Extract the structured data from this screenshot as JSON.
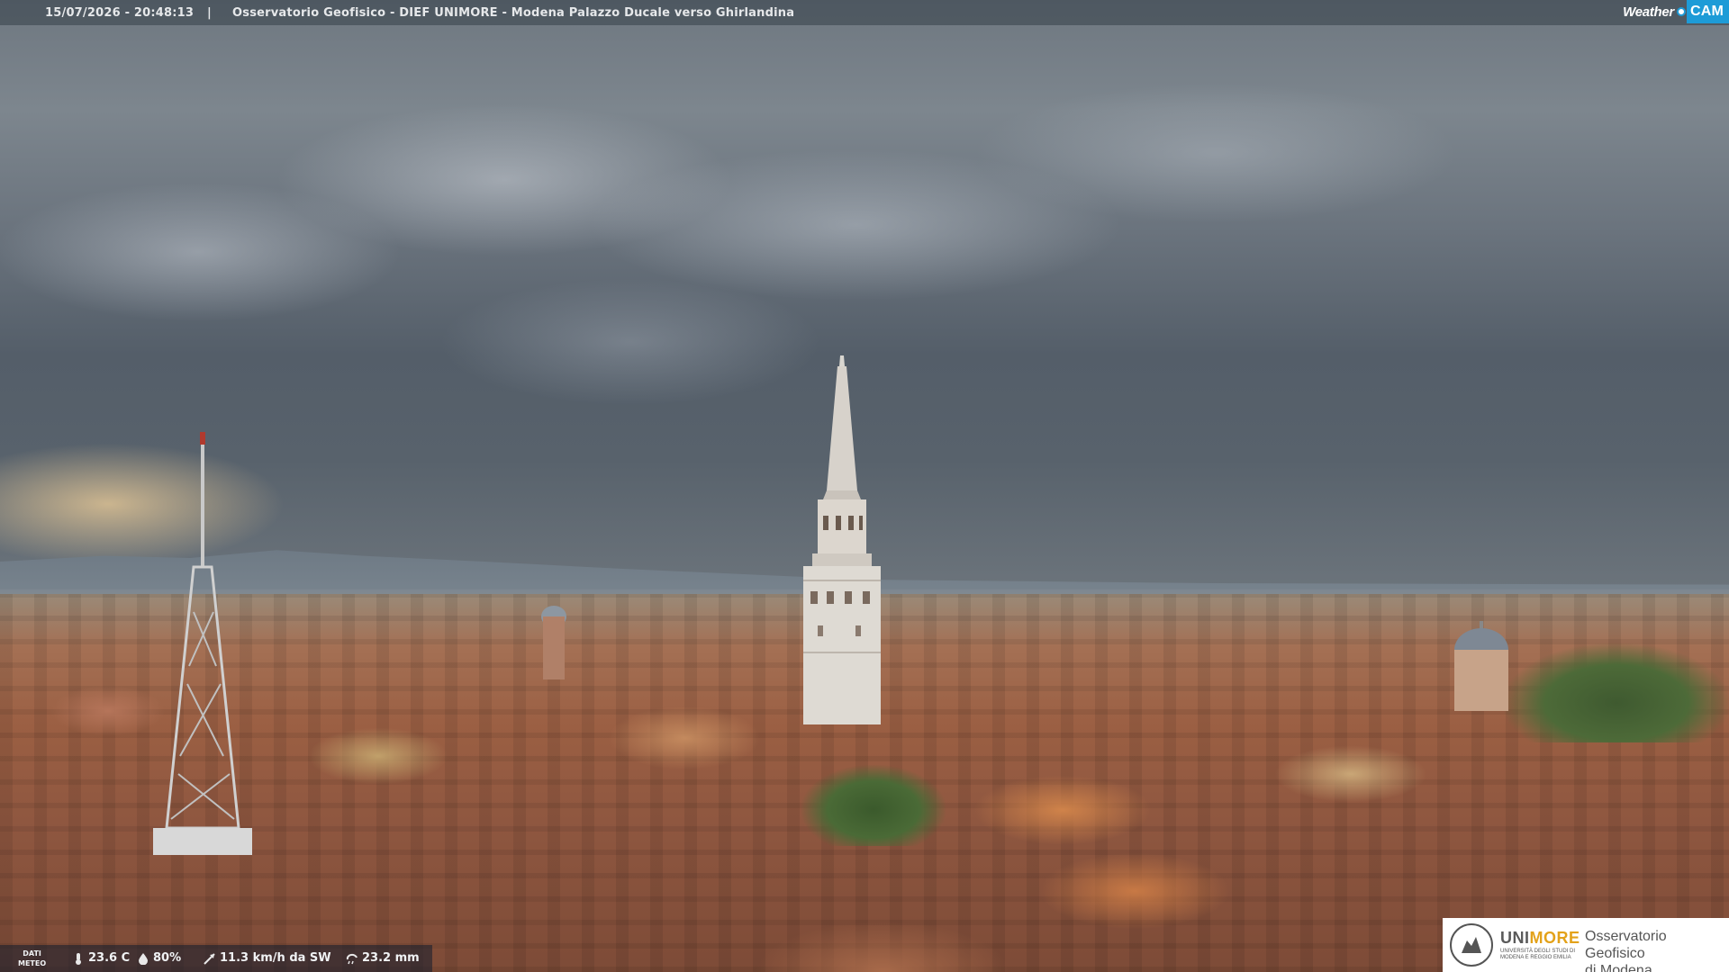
{
  "header": {
    "timestamp": "15/07/2026 - 20:48:13",
    "separator": "|",
    "title": "Osservatorio Geofisico - DIEF UNIMORE - Modena Palazzo Ducale verso Ghirlandina"
  },
  "branding": {
    "weathercam_weather": "Weather",
    "weathercam_cam": "CAM",
    "accent_color": "#1d9bd7"
  },
  "meteo": {
    "tag_line1": "DATI",
    "tag_line2": "METEO",
    "temperature": "23.6 C",
    "humidity": "80%",
    "wind": "11.3 km/h da SW",
    "rain": "23.2 mm",
    "icons": [
      "thermometer-icon",
      "humidity-icon",
      "wind-icon",
      "rain-icon"
    ]
  },
  "logo": {
    "uni": "UNI",
    "more": "MORE",
    "sub_line": "UNIVERSITÀ DEGLI STUDI DI MODENA E REGGIO EMILIA",
    "observatory_line1": "Osservatorio Geofisico",
    "observatory_line2": "di Modena",
    "brand_color": "#e3a21a"
  }
}
